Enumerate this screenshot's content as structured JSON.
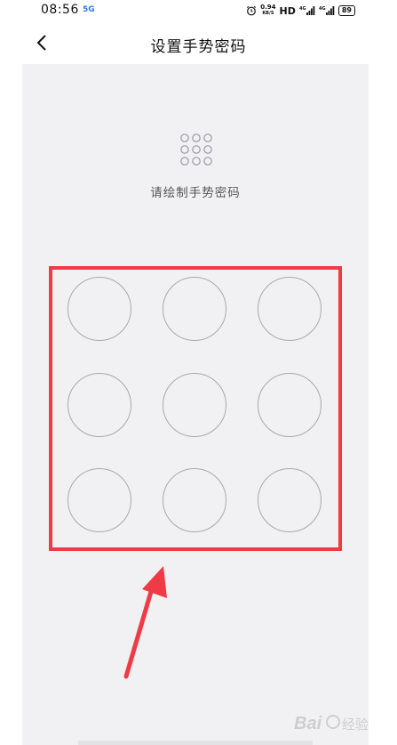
{
  "status_bar": {
    "time": "08:56",
    "network_badge": "5G",
    "speed_value": "0.94",
    "speed_unit": "KB/S",
    "hd_label": "HD",
    "battery": "89"
  },
  "header": {
    "title": "设置手势密码"
  },
  "main": {
    "prompt": "请绘制手势密码"
  },
  "pattern_grid": {
    "rows": 3,
    "cols": 3
  },
  "watermark": {
    "text": "Bai 经验"
  },
  "colors": {
    "panel_background": "#f1f1f3",
    "highlight": "#ef3b45",
    "dot_border": "#a9a9ad",
    "arrow": "#ef3b45"
  }
}
